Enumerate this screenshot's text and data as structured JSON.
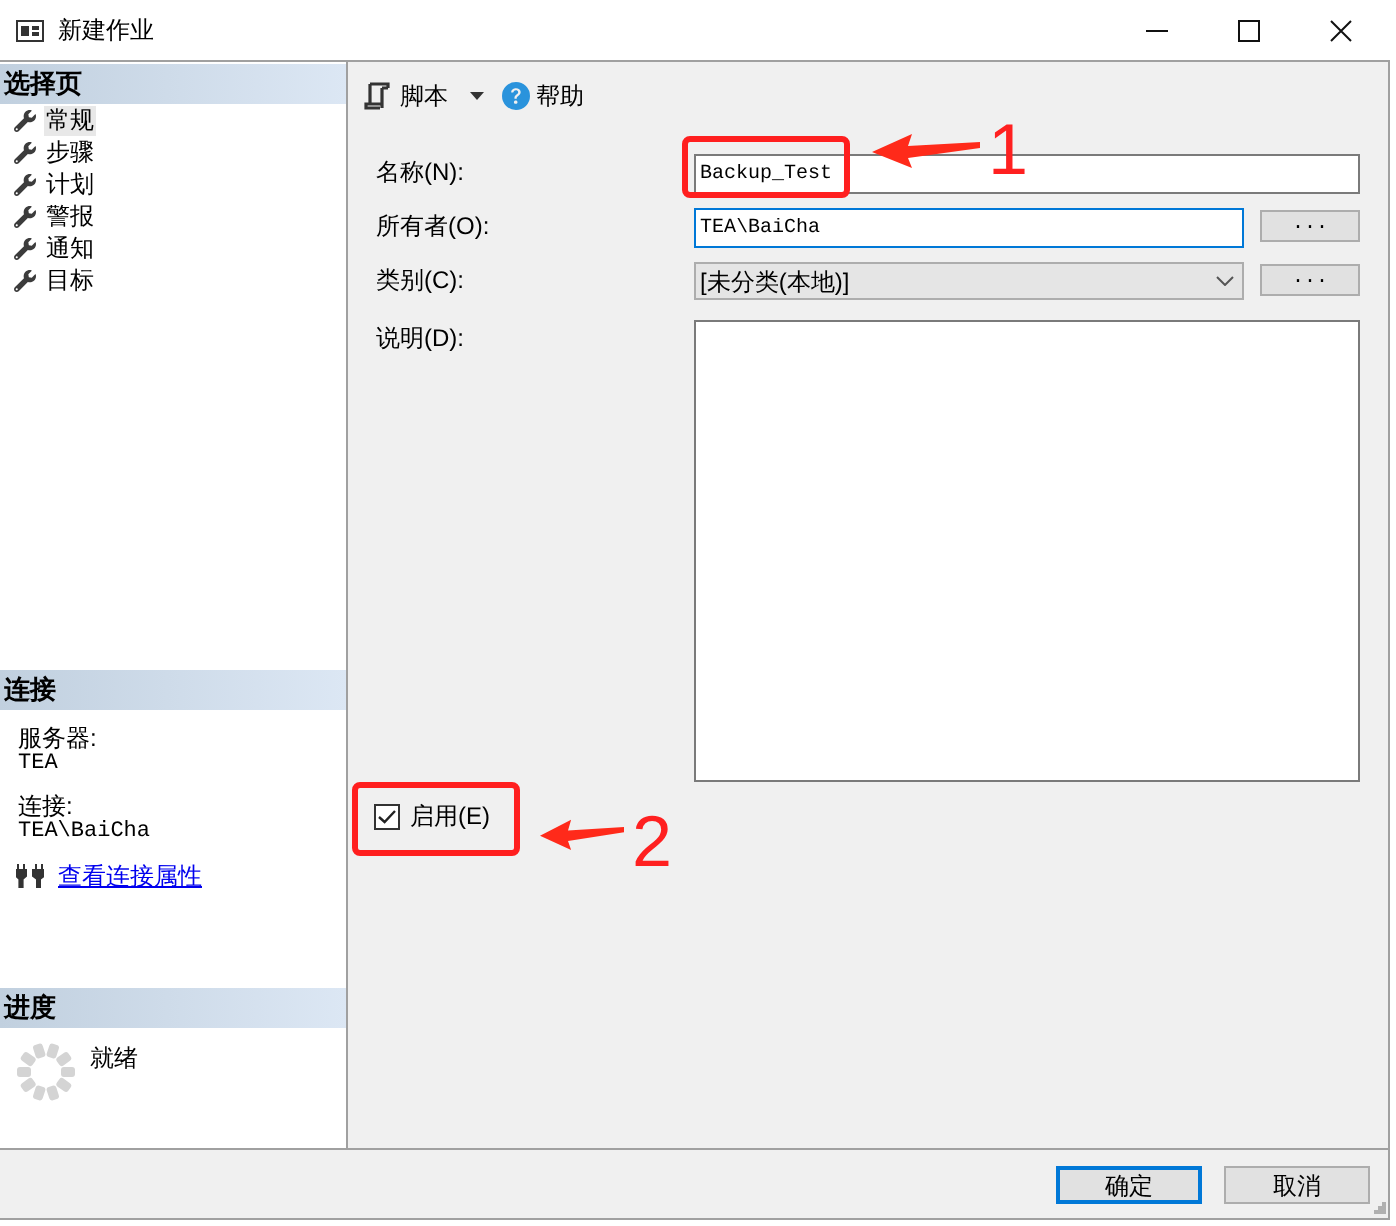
{
  "window": {
    "title": "新建作业"
  },
  "sidebar": {
    "pages": {
      "header": "选择页",
      "items": [
        {
          "label": "常规",
          "selected": true
        },
        {
          "label": "步骤",
          "selected": false
        },
        {
          "label": "计划",
          "selected": false
        },
        {
          "label": "警报",
          "selected": false
        },
        {
          "label": "通知",
          "selected": false
        },
        {
          "label": "目标",
          "selected": false
        }
      ]
    },
    "connection": {
      "header": "连接",
      "server_label": "服务器:",
      "server": "TEA",
      "connection_label": "连接:",
      "connection": "TEA\\BaiCha",
      "link": "查看连接属性"
    },
    "progress": {
      "header": "进度",
      "status": "就绪"
    }
  },
  "toolbar": {
    "script": "脚本",
    "help": "帮助"
  },
  "form": {
    "fields": [
      {
        "kind": "text",
        "label": "名称(N):",
        "value": "Backup_Test",
        "focused": false
      },
      {
        "kind": "text",
        "label": "所有者(O):",
        "value": "TEA\\BaiCha",
        "focused": true,
        "browse": "..."
      },
      {
        "kind": "select",
        "label": "类别(C):",
        "value": "[未分类(本地)]",
        "focused": false,
        "browse": "..."
      },
      {
        "kind": "textarea",
        "label": "说明(D):",
        "focused": false
      }
    ],
    "enabled": {
      "label": "启用(E)",
      "checked": true
    }
  },
  "buttons": [
    {
      "label": "确定",
      "default": true
    },
    {
      "label": "取消",
      "default": false
    }
  ],
  "annotations": [
    {
      "number": "1"
    },
    {
      "number": "2"
    }
  ]
}
